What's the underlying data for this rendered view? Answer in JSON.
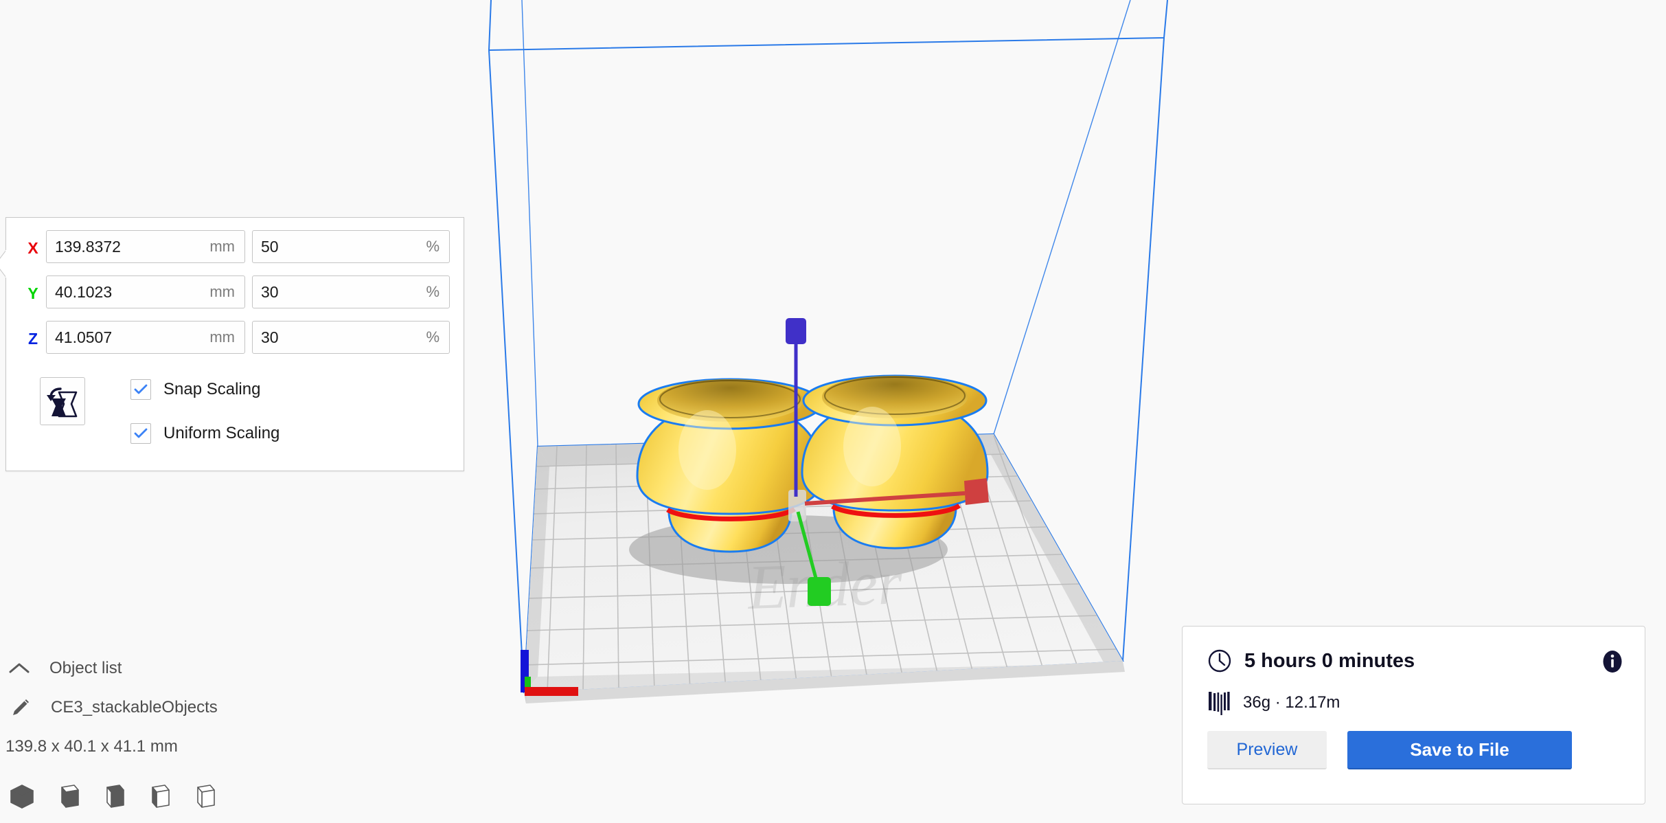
{
  "app": {
    "background_color": "#f9f9f9",
    "accent_color": "#2a6fdb",
    "dark_navy": "#141436"
  },
  "scale_panel": {
    "axes": [
      {
        "label": "X",
        "color": "#e8000a",
        "mm_value": "139.8372",
        "mm_unit": "mm",
        "percent_value": "50",
        "percent_unit": "%"
      },
      {
        "label": "Y",
        "color": "#00d500",
        "mm_value": "40.1023",
        "mm_unit": "mm",
        "percent_value": "30",
        "percent_unit": "%"
      },
      {
        "label": "Z",
        "color": "#0022e0",
        "mm_value": "41.0507",
        "mm_unit": "mm",
        "percent_value": "30",
        "percent_unit": "%"
      }
    ],
    "reset_icon": "reset-scale-icon",
    "checkboxes": [
      {
        "label": "Snap Scaling",
        "checked": true
      },
      {
        "label": "Uniform Scaling",
        "checked": true
      }
    ]
  },
  "object_list": {
    "header_label": "Object list",
    "header_icon": "chevron-up-icon",
    "item_icon": "pencil-icon",
    "item_name": "CE3_stackableObjects",
    "dimensions": "139.8 x 40.1 x 41.1 mm",
    "view_modes": [
      {
        "name": "solid-view-mode"
      },
      {
        "name": "shaded-view-mode"
      },
      {
        "name": "xray-view-mode"
      },
      {
        "name": "layer-view-mode"
      },
      {
        "name": "wireframe-view-mode"
      }
    ]
  },
  "print_info": {
    "time_icon": "clock-icon",
    "time_text": "5 hours 0 minutes",
    "info_icon": "info-icon",
    "material_icon": "filament-icon",
    "material_text": "36g · 12.17m",
    "preview_label": "Preview",
    "save_label": "Save to File"
  },
  "viewport": {
    "build_volume_color": "#2a7ae8",
    "model_color": "#ffd84d",
    "model_outline_color": "#1a7cf0",
    "gizmo": {
      "x_handle_color": "#d04040",
      "y_handle_color": "#22cc22",
      "z_handle_color": "#4030c8"
    },
    "plate_text": "Ender"
  }
}
